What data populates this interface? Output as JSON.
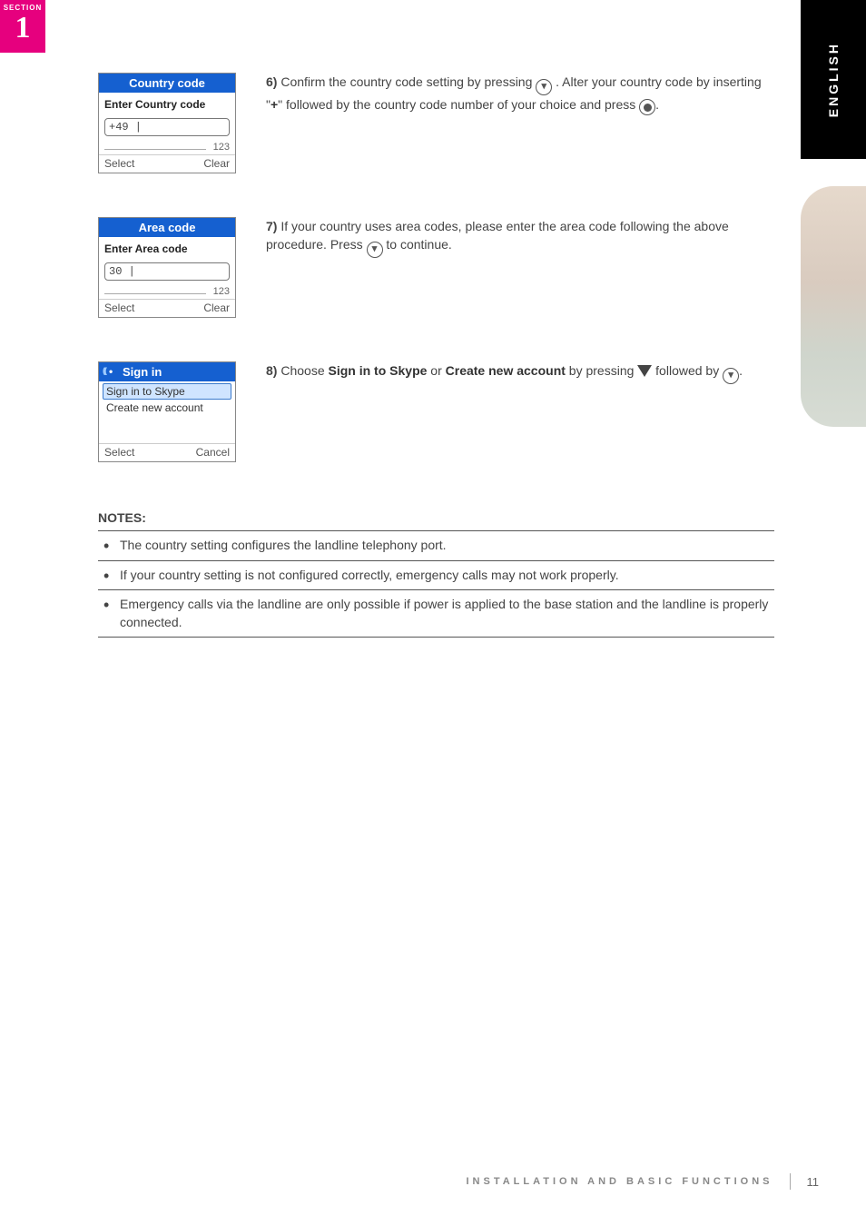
{
  "section_badge": {
    "label": "SECTION",
    "number": "1"
  },
  "language_tab": "ENGLISH",
  "screens": {
    "country": {
      "title": "Country code",
      "subtitle": "Enter Country code",
      "value": "+49 |",
      "mode": "123",
      "soft_left": "Select",
      "soft_right": "Clear"
    },
    "area": {
      "title": "Area code",
      "subtitle": "Enter Area code",
      "value": "30 |",
      "mode": "123",
      "soft_left": "Select",
      "soft_right": "Clear"
    },
    "signin": {
      "title": "Sign in",
      "item_selected": "Sign in to Skype",
      "item_other": "Create new account",
      "soft_left": "Select",
      "soft_right": "Cancel"
    }
  },
  "steps": {
    "s6": {
      "num": "6)",
      "text_a": "Confirm the country code setting by pressing ",
      "text_b": ". Alter your country code by inserting \"",
      "plus": "+",
      "text_c": "\" followed by the country code number of your choice and press ",
      "text_d": "."
    },
    "s7": {
      "num": "7)",
      "text_a": "If your country uses area codes, please enter the area code following the above procedure. Press ",
      "text_b": " to continue."
    },
    "s8": {
      "num": "8)",
      "text_a": "Choose ",
      "bold_a": "Sign in to Skype",
      "text_b": " or ",
      "bold_b": "Create new account",
      "text_c": " by pressing ",
      "text_d": " followed by ",
      "text_e": "."
    }
  },
  "notes": {
    "heading": "NOTES:",
    "items": [
      "The country setting configures the landline telephony port.",
      "If your country setting is not configured correctly, emergency calls may not work properly.",
      "Emergency calls via the landline are only possible if power is applied to the base station and the landline is properly connected."
    ]
  },
  "footer": {
    "text": "INSTALLATION AND BASIC FUNCTIONS",
    "page": "11"
  }
}
